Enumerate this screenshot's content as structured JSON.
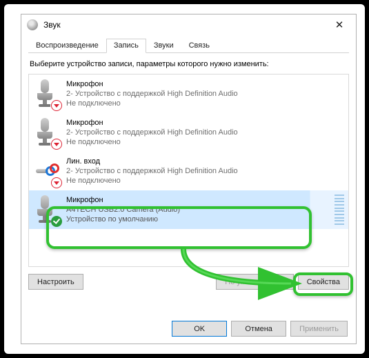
{
  "window": {
    "title": "Звук"
  },
  "tabs": [
    "Воспроизведение",
    "Запись",
    "Звуки",
    "Связь"
  ],
  "activeTab": 1,
  "instruction": "Выберите устройство записи, параметры которого нужно изменить:",
  "devices": [
    {
      "name": "Микрофон",
      "desc": "2- Устройство с поддержкой High Definition Audio",
      "status": "Не подключено",
      "iconType": "mic",
      "badge": "down"
    },
    {
      "name": "Микрофон",
      "desc": "2- Устройство с поддержкой High Definition Audio",
      "status": "Не подключено",
      "iconType": "mic",
      "badge": "down"
    },
    {
      "name": "Лин. вход",
      "desc": "2- Устройство с поддержкой High Definition Audio",
      "status": "Не подключено",
      "iconType": "linein",
      "badge": "down"
    },
    {
      "name": "Микрофон",
      "desc": "A4TECH USB2.0 Camera (Audio)",
      "status": "Устройство по умолчанию",
      "iconType": "mic",
      "badge": "ok",
      "selected": true
    }
  ],
  "buttons": {
    "configure": "Настроить",
    "setDefault": "По умолчанию",
    "properties": "Свойства",
    "ok": "OK",
    "cancel": "Отмена",
    "apply": "Применить"
  }
}
